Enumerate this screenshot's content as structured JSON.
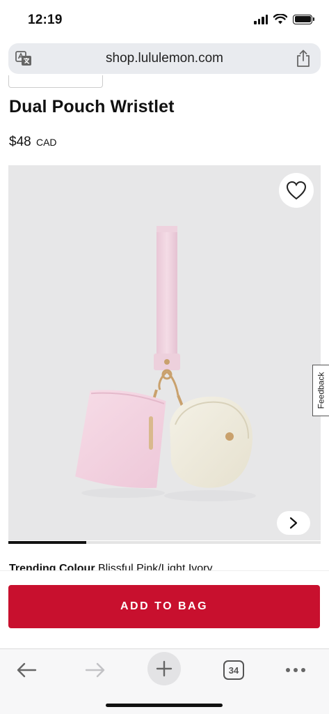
{
  "status_bar": {
    "time": "12:19"
  },
  "browser": {
    "url": "shop.lululemon.com",
    "tab_count": "34"
  },
  "product": {
    "title": "Dual Pouch Wristlet",
    "price": "$48",
    "currency": "CAD",
    "image_progress": 0.25,
    "colors": {
      "pink": "#f3d3e1",
      "ivory": "#eeeadd",
      "accent": "#c8102e"
    }
  },
  "feedback": {
    "label": "Feedback"
  },
  "colour": {
    "label": "Trending Colour",
    "value": "Blissful Pink/Light Ivory"
  },
  "cta": {
    "add_to_bag": "ADD TO BAG"
  },
  "icons": {
    "translate": "translate-icon",
    "share": "share-icon",
    "heart": "heart-icon",
    "next": "chevron-right-icon",
    "back": "arrow-left-icon",
    "forward": "arrow-right-icon",
    "new_tab": "plus-icon",
    "more": "ellipsis-icon"
  }
}
